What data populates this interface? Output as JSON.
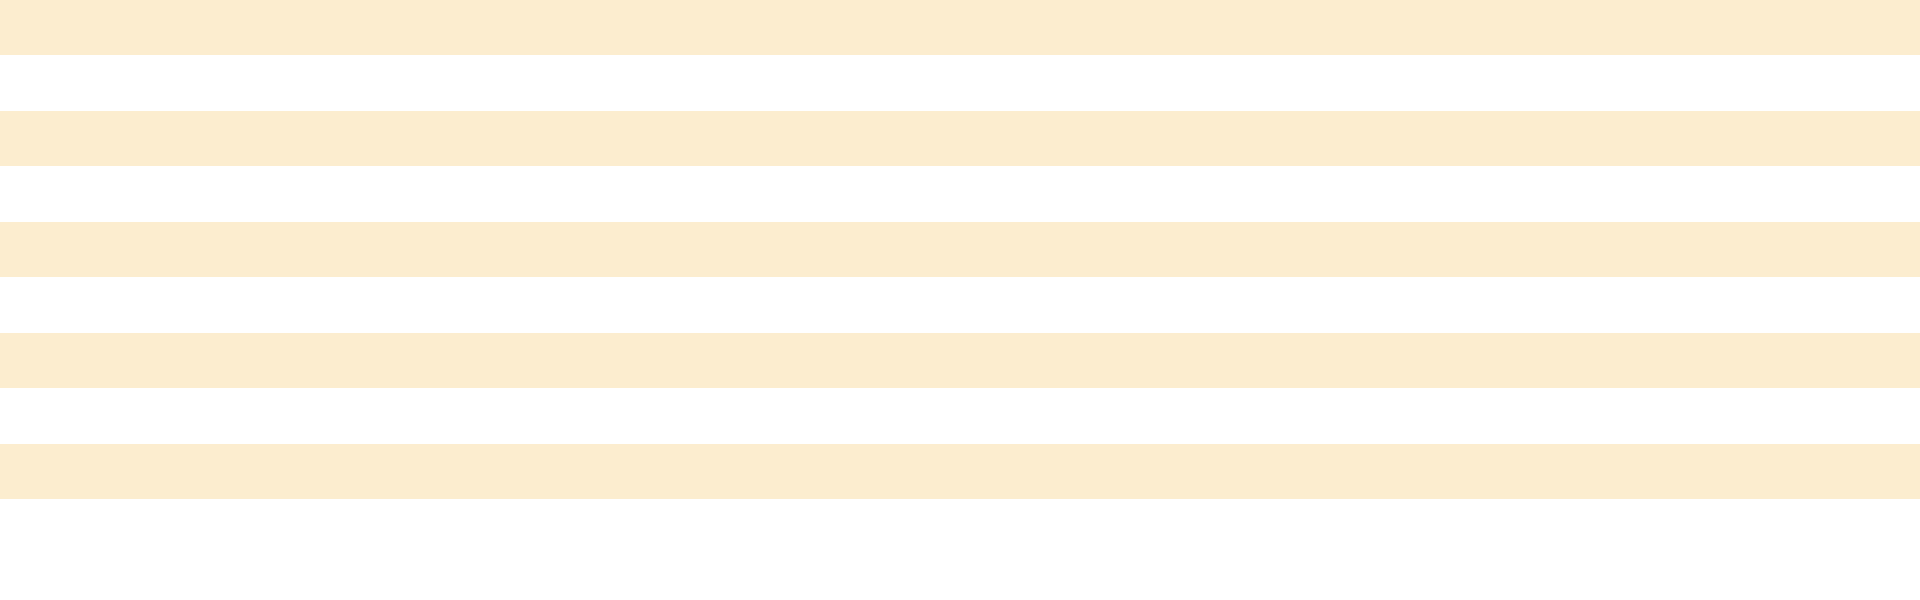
{
  "background": {
    "page_color": "#ffffff",
    "stripe_color": "#fcedcf",
    "stripe_count": 5
  }
}
